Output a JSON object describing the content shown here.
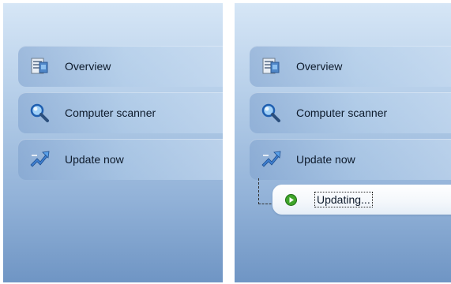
{
  "nav": {
    "items": [
      {
        "label": "Overview",
        "icon": "overview-icon"
      },
      {
        "label": "Computer scanner",
        "icon": "magnifier-icon"
      },
      {
        "label": "Update now",
        "icon": "update-icon"
      }
    ]
  },
  "update_status": {
    "label": "Updating...",
    "icon": "play-icon"
  },
  "colors": {
    "panel_top": "#d6e6f6",
    "panel_bottom": "#6f95c4",
    "status_green": "#3fa52a"
  }
}
